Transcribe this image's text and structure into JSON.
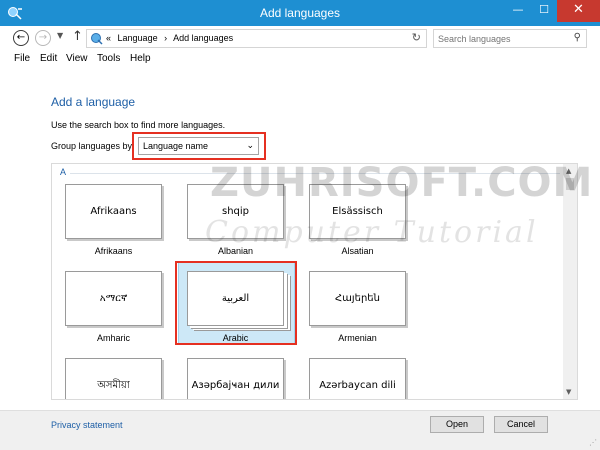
{
  "window": {
    "title": "Add languages",
    "min_glyph": "—",
    "max_glyph": "☐",
    "close_glyph": "✕"
  },
  "address": {
    "chevrons": "«",
    "crumbs": [
      "Language",
      "Add languages"
    ],
    "separator": "›",
    "search_placeholder": "Search languages"
  },
  "menu": [
    "File",
    "Edit",
    "View",
    "Tools",
    "Help"
  ],
  "main": {
    "heading": "Add a language",
    "instructions": "Use the search box to find more languages.",
    "group_label": "Group languages by",
    "group_value": "Language name",
    "group_header": "A"
  },
  "languages": [
    {
      "native": "Afrikaans",
      "name": "Afrikaans"
    },
    {
      "native": "shqip",
      "name": "Albanian"
    },
    {
      "native": "Elsässisch",
      "name": "Alsatian"
    },
    {
      "native": "አማርኛ",
      "name": "Amharic"
    },
    {
      "native": "العربية",
      "name": "Arabic"
    },
    {
      "native": "Հայերեն",
      "name": "Armenian"
    },
    {
      "native": "অসমীয়া",
      "name": ""
    },
    {
      "native": "Азәрбајҹан дили",
      "name": ""
    },
    {
      "native": "Azərbaycan dili",
      "name": ""
    }
  ],
  "footer": {
    "privacy": "Privacy statement",
    "open": "Open",
    "cancel": "Cancel"
  },
  "watermark": {
    "line1": "ZUHRISOFT.COM",
    "line2": "Computer Tutorial"
  },
  "colors": {
    "titlebar": "#1e8fd2",
    "close": "#c7392f",
    "heading": "#1e5fa6",
    "highlight_box": "#e53021",
    "selected_tile": "#cde8f7"
  }
}
